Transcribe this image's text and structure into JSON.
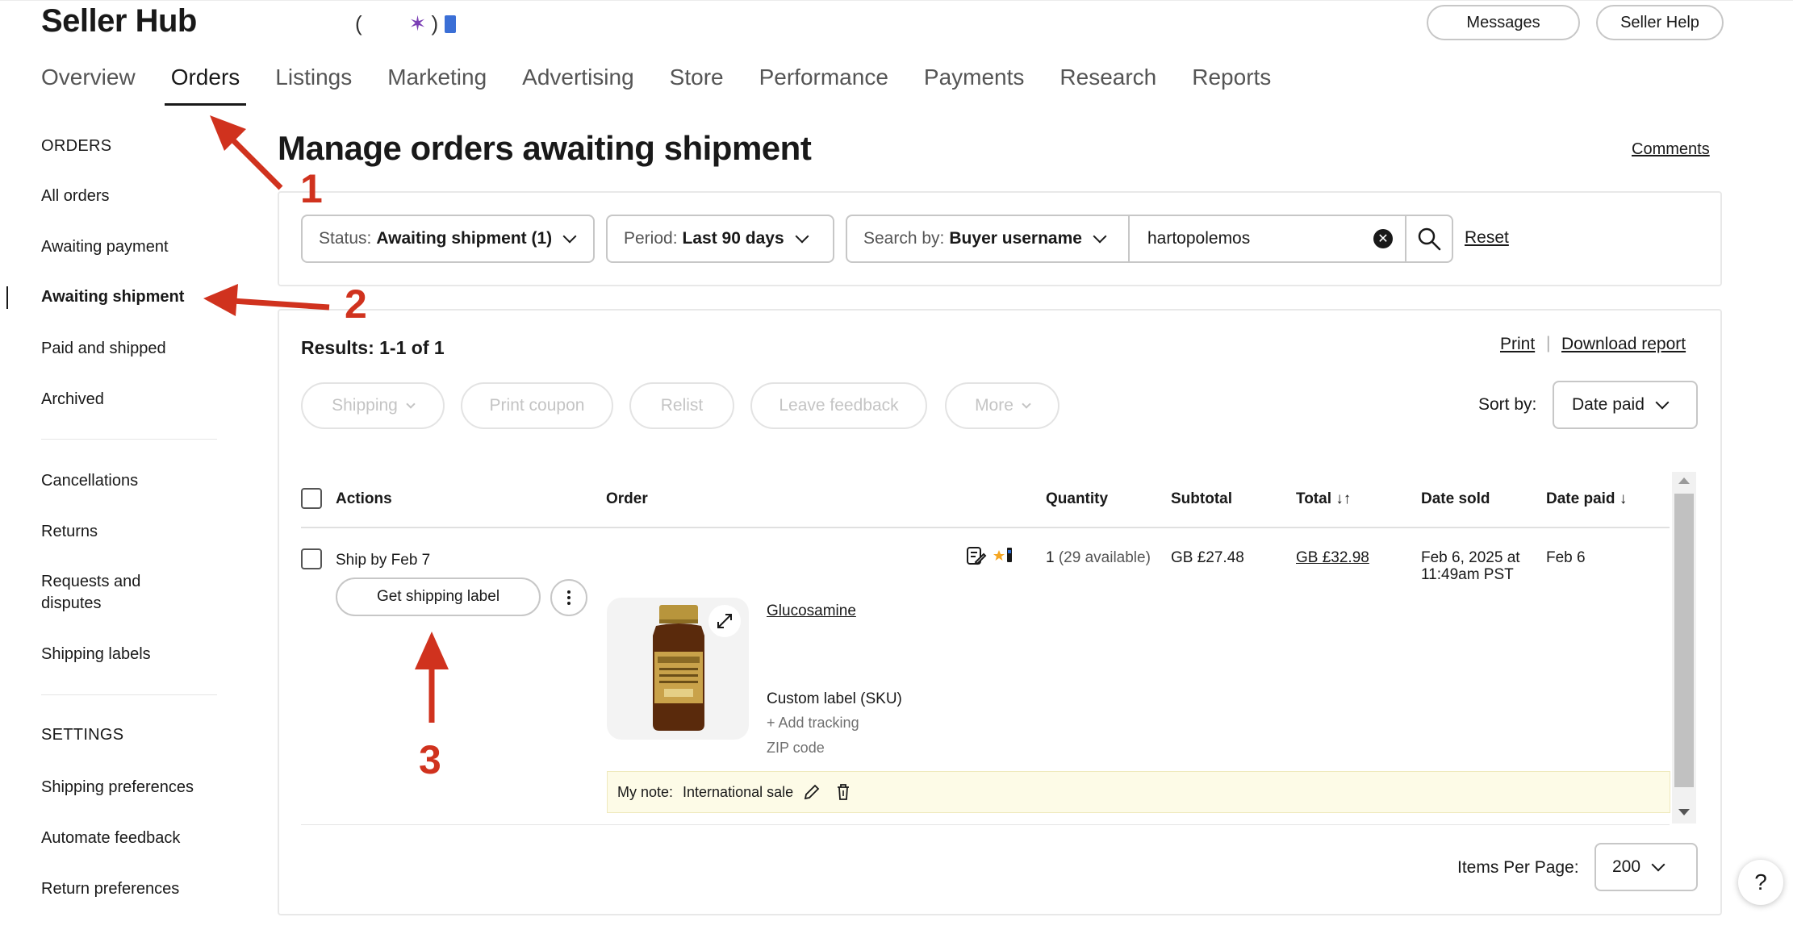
{
  "header": {
    "brand": "Seller Hub",
    "brand_extra_open": "(",
    "brand_extra_star": "✶",
    "brand_extra_close": ")",
    "messages_label": "Messages",
    "seller_help_label": "Seller Help"
  },
  "topnav": {
    "tabs": [
      "Overview",
      "Orders",
      "Listings",
      "Marketing",
      "Advertising",
      "Store",
      "Performance",
      "Payments",
      "Research",
      "Reports"
    ],
    "active": "Orders"
  },
  "sidebar": {
    "orders_heading": "ORDERS",
    "order_items": [
      "All orders",
      "Awaiting payment",
      "Awaiting shipment",
      "Paid and shipped",
      "Archived"
    ],
    "other_items": [
      "Cancellations",
      "Returns",
      "Requests and",
      "disputes",
      "Shipping labels"
    ],
    "settings_heading": "SETTINGS",
    "settings_items": [
      "Shipping preferences",
      "Automate feedback",
      "Return preferences"
    ],
    "active": "Awaiting shipment"
  },
  "main": {
    "title": "Manage orders awaiting shipment",
    "comments_link": "Comments"
  },
  "filters": {
    "status_label": "Status:",
    "status_value": "Awaiting shipment (1)",
    "period_label": "Period:",
    "period_value": "Last 90 days",
    "search_by_label": "Search by:",
    "search_by_value": "Buyer username",
    "search_value": "hartopolemos",
    "reset_label": "Reset"
  },
  "results": {
    "count": "Results: 1-1 of 1",
    "print_link": "Print",
    "separator": "|",
    "download_link": "Download report",
    "bulk_actions": [
      "Shipping",
      "Print coupon",
      "Relist",
      "Leave feedback",
      "More"
    ],
    "sort_by_label": "Sort by:",
    "sort_by_value": "Date paid"
  },
  "table": {
    "columns": {
      "actions": "Actions",
      "order": "Order",
      "quantity": "Quantity",
      "subtotal": "Subtotal",
      "total": "Total",
      "total_sort_icon": "↓↑",
      "date_sold": "Date sold",
      "date_paid": "Date paid",
      "date_paid_sort_icon": "↓"
    },
    "row": {
      "ship_by": "Ship by Feb 7",
      "ship_button": "Get shipping label",
      "quantity": "1",
      "available": "(29 available)",
      "subtotal": "GB £27.48",
      "total": "GB £32.98",
      "date_sold_line1": "Feb 6, 2025 at",
      "date_sold_line2": "11:49am PST",
      "date_paid": "Feb 6",
      "product_name": "Glucosamine",
      "custom_label": "Custom label (SKU)",
      "add_tracking": "+ Add tracking",
      "zip_code": "ZIP code",
      "note_label": "My note:",
      "note_text": "International sale"
    }
  },
  "pagination": {
    "items_per_page_label": "Items Per Page:",
    "items_per_page_value": "200"
  },
  "help_fab": "?",
  "annotations": {
    "labels": [
      "1",
      "2",
      "3"
    ],
    "color": "#d0321e"
  },
  "icons": {
    "search": "search-icon",
    "clear": "clear-icon",
    "expand": "expand-icon",
    "edit": "pencil-icon",
    "delete": "trash-icon",
    "kebab": "more-vertical-icon"
  }
}
